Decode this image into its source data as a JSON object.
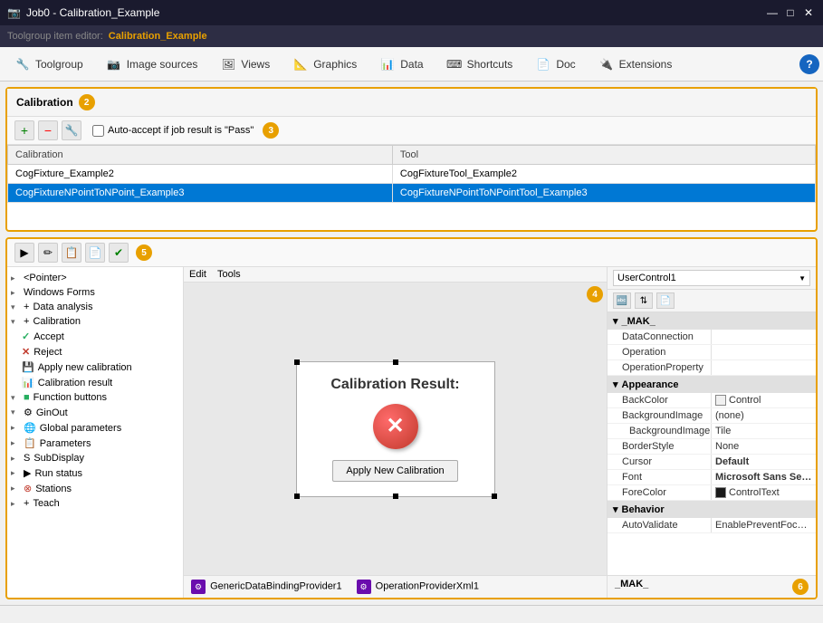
{
  "titlebar": {
    "icon": "📷",
    "title": "Job0 - Calibration_Example",
    "min_btn": "—",
    "max_btn": "□",
    "close_btn": "✕"
  },
  "app_toolbar": {
    "label": "Toolgroup item editor:",
    "title": "Calibration_Example"
  },
  "menu_tabs": [
    {
      "id": "toolgroup",
      "label": "Toolgroup",
      "icon": "🔧"
    },
    {
      "id": "image-sources",
      "label": "Image sources",
      "icon": "📷"
    },
    {
      "id": "views",
      "label": "Views",
      "icon": "🖼"
    },
    {
      "id": "graphics",
      "label": "Graphics",
      "icon": "📐"
    },
    {
      "id": "data",
      "label": "Data",
      "icon": "📊"
    },
    {
      "id": "shortcuts",
      "label": "Shortcuts",
      "icon": "⌨"
    },
    {
      "id": "doc",
      "label": "Doc",
      "icon": "📄"
    },
    {
      "id": "extensions",
      "label": "Extensions",
      "icon": "🔌"
    }
  ],
  "help_badge": "?",
  "top_panel": {
    "title": "Calibration",
    "badge": "2",
    "auto_accept_label": "Auto-accept if job result is \"Pass\"",
    "table_headers": [
      "Calibration",
      "Tool"
    ],
    "table_rows": [
      {
        "calibration": "CogFixture_Example2",
        "tool": "CogFixtureTool_Example2",
        "selected": false
      },
      {
        "calibration": "CogFixtureNPointToNPoint_Example3",
        "tool": "CogFixtureNPointToNPointTool_Example3",
        "selected": true
      }
    ],
    "badge3": "3"
  },
  "bottom_panel": {
    "badge5": "5",
    "badge4": "4",
    "badge6": "6",
    "toolbar_buttons": [
      "▶",
      "✏",
      "📋",
      "📄",
      "✔"
    ],
    "tree_items": [
      {
        "label": "<Pointer>",
        "indent": 0,
        "expand": false
      },
      {
        "label": "Windows Forms",
        "indent": 0,
        "expand": false
      },
      {
        "label": "Data analysis",
        "indent": 0,
        "expand": true,
        "icon": "📊"
      },
      {
        "label": "Calibration",
        "indent": 0,
        "expand": true,
        "icon": "🎯"
      },
      {
        "label": "Accept",
        "indent": 1,
        "icon": "✓",
        "icon_color": "green"
      },
      {
        "label": "Reject",
        "indent": 1,
        "icon": "✗",
        "icon_color": "red"
      },
      {
        "label": "Apply new calibration",
        "indent": 1,
        "icon": "💾"
      },
      {
        "label": "Calibration result",
        "indent": 1,
        "icon": "📊"
      },
      {
        "label": "Function buttons",
        "indent": 0,
        "expand": true,
        "icon": "🟩"
      },
      {
        "label": "GinOut",
        "indent": 0,
        "expand": true,
        "icon": "⚙"
      },
      {
        "label": "Global parameters",
        "indent": 0,
        "expand": false,
        "icon": "🌐"
      },
      {
        "label": "Parameters",
        "indent": 0,
        "expand": false,
        "icon": "📋"
      },
      {
        "label": "SubDisplay",
        "indent": 0,
        "expand": false,
        "icon": "🖥"
      },
      {
        "label": "Run status",
        "indent": 0,
        "expand": false,
        "icon": "▶"
      },
      {
        "label": "Stations",
        "indent": 0,
        "expand": false,
        "icon": "🔴"
      },
      {
        "label": "Teach",
        "indent": 0,
        "expand": false,
        "icon": "📚"
      }
    ],
    "design_menu": [
      "Edit",
      "Tools"
    ],
    "widget": {
      "title": "Calibration Result:",
      "x_symbol": "✕",
      "apply_btn_label": "Apply New Calibration"
    },
    "footer_providers": [
      {
        "icon": "⚙",
        "label": "GenericDataBindingProvider1"
      },
      {
        "icon": "⚙",
        "label": "OperationProviderXml1"
      }
    ],
    "props": {
      "dropdown_value": "UserControl1",
      "sections": [
        {
          "type": "section",
          "label": "_MAK_",
          "rows": [
            {
              "name": "DataConnection",
              "value": ""
            },
            {
              "name": "Operation",
              "value": ""
            },
            {
              "name": "OperationProperty",
              "value": ""
            }
          ]
        },
        {
          "type": "section",
          "label": "Appearance",
          "rows": [
            {
              "name": "BackColor",
              "value": "Control",
              "has_swatch": true,
              "swatch_color": "#f0f0f0"
            },
            {
              "name": "BackgroundImage",
              "value": "(none)"
            },
            {
              "name": "BackgroundImage",
              "value": "Tile"
            },
            {
              "name": "BorderStyle",
              "value": "None"
            },
            {
              "name": "Cursor",
              "value": "Default",
              "bold": true
            },
            {
              "name": "Font",
              "value": "Microsoft Sans Se…",
              "bold": true
            },
            {
              "name": "ForeColor",
              "value": "ControlText",
              "has_swatch": true,
              "swatch_color": "#1a1a1a"
            }
          ]
        },
        {
          "type": "section",
          "label": "Behavior",
          "rows": [
            {
              "name": "AutoValidate",
              "value": "EnablePreventFoc…"
            }
          ]
        }
      ],
      "footer_label": "_MAK_"
    }
  }
}
